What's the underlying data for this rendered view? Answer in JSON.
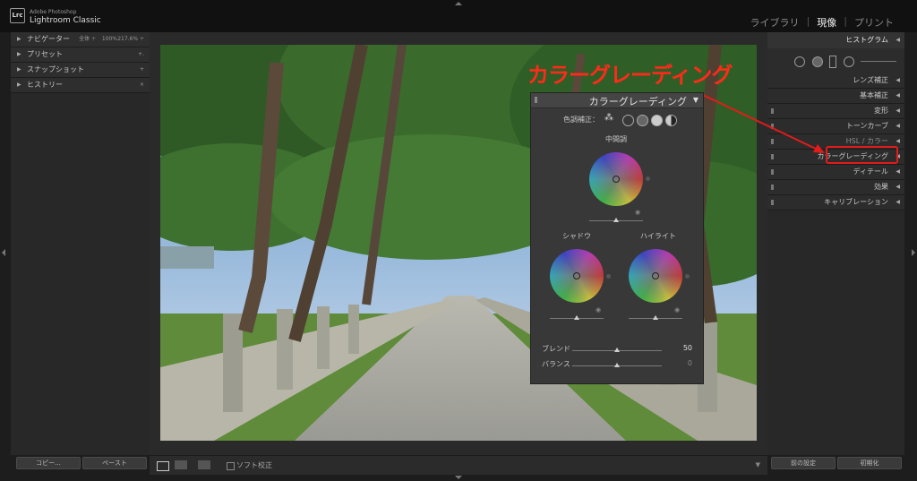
{
  "app": {
    "subtitle": "Adobe Photoshop",
    "name": "Lightroom Classic",
    "logo": "Lrc"
  },
  "modules": [
    {
      "label": "ライブラリ",
      "active": false
    },
    {
      "label": "現像",
      "active": true
    },
    {
      "label": "プリント",
      "active": false
    }
  ],
  "left_panel": {
    "sections": [
      {
        "label": "ナビゲーター",
        "extras": [
          "全体 ÷",
          "100%",
          "217.6% ÷"
        ]
      },
      {
        "label": "プリセット",
        "extras": [
          "+."
        ]
      },
      {
        "label": "スナップショット",
        "extras": [
          "+"
        ]
      },
      {
        "label": "ヒストリー",
        "extras": [
          "×"
        ]
      }
    ],
    "copy_button": "コピー...",
    "paste_button": "ペースト"
  },
  "right_panel": {
    "histogram_label": "ヒストグラム",
    "sections": [
      "レンズ補正",
      "基本補正",
      "変形",
      "トーンカーブ",
      "HSL / カラー",
      "カラーグレーディング",
      "ディテール",
      "効果",
      "キャリブレーション"
    ],
    "previous_button": "前の設定",
    "reset_button": "初期化"
  },
  "toolbar": {
    "softproof_label": "ソフト校正"
  },
  "annotation": {
    "text": "カラーグレーディング",
    "color": "#ff2a1a"
  },
  "color_grading_panel": {
    "title": "カラーグレーディング",
    "mode_label": "色調補正：",
    "midtones_label": "中間調",
    "shadows_label": "シャドウ",
    "highlights_label": "ハイライト",
    "blend_label": "ブレンド",
    "blend_value": "50",
    "balance_label": "バランス",
    "balance_value": "0"
  }
}
